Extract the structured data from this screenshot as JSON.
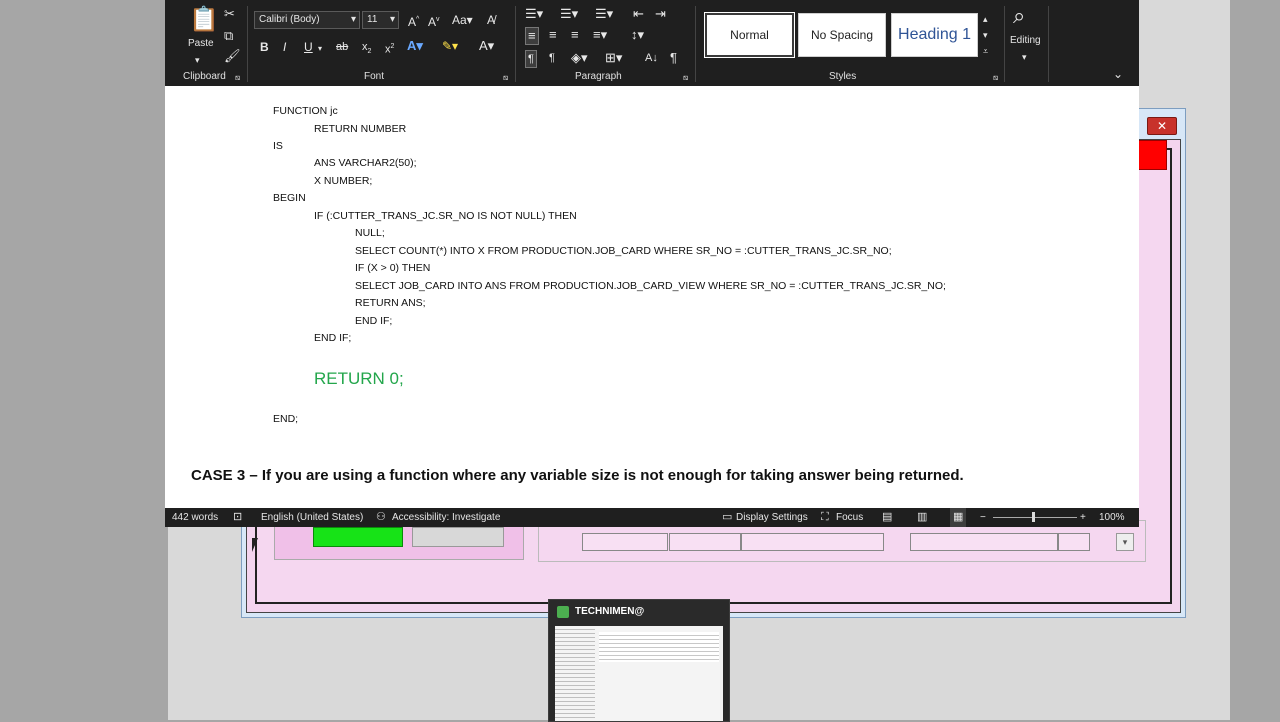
{
  "ribbon": {
    "clipboard": {
      "paste_label": "Paste",
      "group_label": "Clipboard"
    },
    "font": {
      "family": "Calibri (Body)",
      "size": "11",
      "group_label": "Font"
    },
    "paragraph": {
      "group_label": "Paragraph"
    },
    "styles": {
      "group_label": "Styles",
      "items": [
        "Normal",
        "No Spacing",
        "Heading 1"
      ]
    },
    "editing": {
      "label": "Editing"
    }
  },
  "document": {
    "code_lines": [
      "FUNCTION jc",
      "RETURN NUMBER",
      "IS",
      "ANS VARCHAR2(50);",
      "X NUMBER;",
      "BEGIN",
      "IF (:CUTTER_TRANS_JC.SR_NO IS NOT NULL) THEN",
      "NULL;",
      "SELECT COUNT(*) INTO X FROM PRODUCTION.JOB_CARD WHERE SR_NO = :CUTTER_TRANS_JC.SR_NO;",
      "IF (X > 0) THEN",
      "SELECT JOB_CARD INTO ANS FROM PRODUCTION.JOB_CARD_VIEW WHERE SR_NO = :CUTTER_TRANS_JC.SR_NO;",
      "RETURN ANS;",
      "END IF;",
      "END IF;",
      "END;"
    ],
    "return_zero": "RETURN 0;",
    "case_heading": "CASE 3 – If you are using a function where any variable size is not enough for taking answer being returned."
  },
  "status_bar": {
    "word_count": "442 words",
    "language": "English (United States)",
    "accessibility": "Accessibility: Investigate",
    "display_settings": "Display Settings",
    "focus": "Focus",
    "zoom": "100%"
  },
  "taskbar_thumb": {
    "title": "TECHNIMEN@"
  }
}
